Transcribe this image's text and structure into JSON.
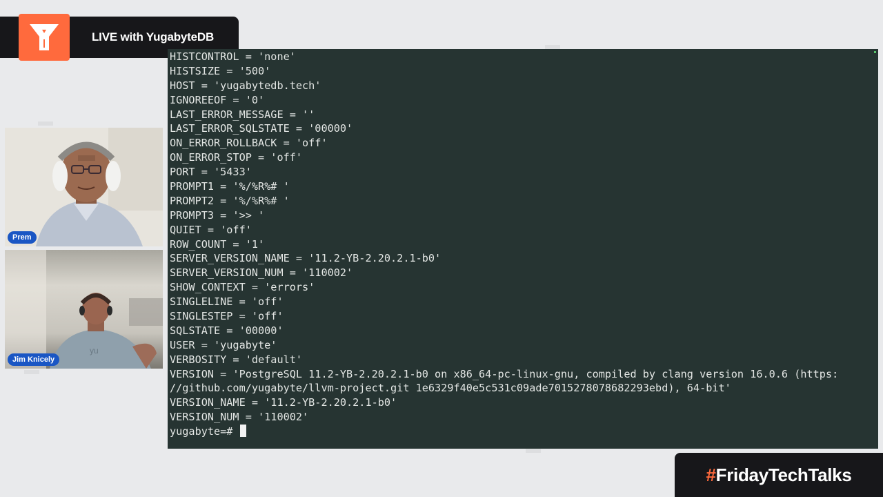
{
  "banner": {
    "title": "LIVE with YugabyteDB"
  },
  "participants": [
    {
      "name": "Prem"
    },
    {
      "name": "Jim Knicely"
    }
  ],
  "hashtag": {
    "symbol": "#",
    "text": "FridayTechTalks"
  },
  "terminal": {
    "lines": [
      "HISTCONTROL = 'none'",
      "HISTSIZE = '500'",
      "HOST = 'yugabytedb.tech'",
      "IGNOREEOF = '0'",
      "LAST_ERROR_MESSAGE = ''",
      "LAST_ERROR_SQLSTATE = '00000'",
      "ON_ERROR_ROLLBACK = 'off'",
      "ON_ERROR_STOP = 'off'",
      "PORT = '5433'",
      "PROMPT1 = '%/%R%# '",
      "PROMPT2 = '%/%R%# '",
      "PROMPT3 = '>> '",
      "QUIET = 'off'",
      "ROW_COUNT = '1'",
      "SERVER_VERSION_NAME = '11.2-YB-2.20.2.1-b0'",
      "SERVER_VERSION_NUM = '110002'",
      "SHOW_CONTEXT = 'errors'",
      "SINGLELINE = 'off'",
      "SINGLESTEP = 'off'",
      "SQLSTATE = '00000'",
      "USER = 'yugabyte'",
      "VERBOSITY = 'default'",
      "VERSION = 'PostgreSQL 11.2-YB-2.20.2.1-b0 on x86_64-pc-linux-gnu, compiled by clang version 16.0.6 (https:",
      "//github.com/yugabyte/llvm-project.git 1e6329f40e5c531c09ade7015278078682293ebd), 64-bit'",
      "VERSION_NAME = '11.2-YB-2.20.2.1-b0'",
      "VERSION_NUM = '110002'"
    ],
    "prompt": "yugabyte=# "
  },
  "colors": {
    "brand_orange": "#ff6a3d",
    "terminal_bg": "#263432",
    "banner_bg": "#17171a",
    "name_tag": "#1a56c4"
  }
}
